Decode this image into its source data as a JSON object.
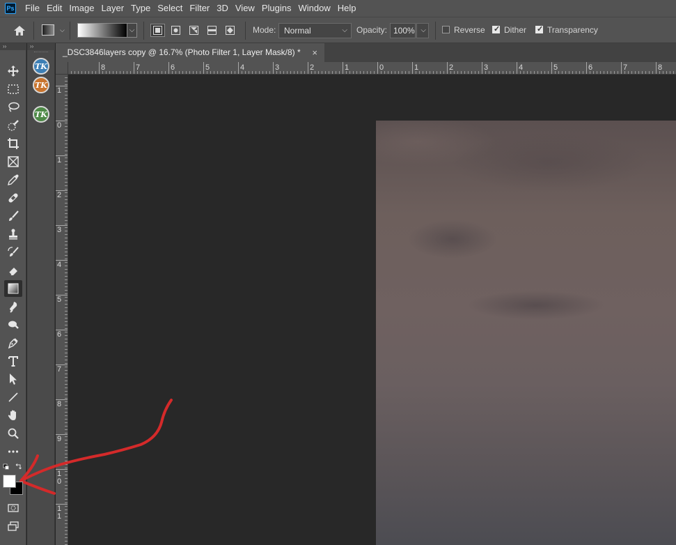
{
  "app": {
    "logo": "Ps"
  },
  "menu": [
    "File",
    "Edit",
    "Image",
    "Layer",
    "Type",
    "Select",
    "Filter",
    "3D",
    "View",
    "Plugins",
    "Window",
    "Help"
  ],
  "options": {
    "mode_label": "Mode:",
    "mode_value": "Normal",
    "opacity_label": "Opacity:",
    "opacity_value": "100%",
    "reverse_label": "Reverse",
    "reverse_checked": false,
    "dither_label": "Dither",
    "dither_checked": true,
    "transparency_label": "Transparency",
    "transparency_checked": true
  },
  "panel_collapse": "››",
  "document": {
    "tab_title": "_DSC3846layers copy @ 16.7% (Photo Filter 1, Layer Mask/8) *",
    "close_glyph": "×"
  },
  "ruler": {
    "horizontal_labels": [
      "8",
      "7",
      "6",
      "5",
      "4",
      "3",
      "2",
      "1",
      "0",
      "1",
      "2",
      "3",
      "4",
      "5",
      "6",
      "7",
      "8"
    ],
    "vertical_labels": [
      "1",
      "0",
      "1",
      "2",
      "3",
      "4",
      "5",
      "6",
      "7",
      "8",
      "9",
      "10",
      "11"
    ]
  },
  "tools": [
    {
      "name": "move-tool"
    },
    {
      "name": "marquee-tool"
    },
    {
      "name": "lasso-tool"
    },
    {
      "name": "quick-selection-tool"
    },
    {
      "name": "crop-tool"
    },
    {
      "name": "frame-tool"
    },
    {
      "name": "eyedropper-tool"
    },
    {
      "name": "healing-brush-tool"
    },
    {
      "name": "brush-tool"
    },
    {
      "name": "clone-stamp-tool"
    },
    {
      "name": "history-brush-tool"
    },
    {
      "name": "eraser-tool"
    },
    {
      "name": "gradient-tool",
      "active": true
    },
    {
      "name": "blur-tool"
    },
    {
      "name": "dodge-tool"
    },
    {
      "name": "pen-tool"
    },
    {
      "name": "type-tool"
    },
    {
      "name": "path-selection-tool"
    },
    {
      "name": "line-tool"
    },
    {
      "name": "hand-tool"
    },
    {
      "name": "zoom-tool"
    },
    {
      "name": "more-tools"
    }
  ],
  "tk_panels": [
    "TK",
    "TK",
    "TK"
  ],
  "colors": {
    "foreground": "#ffffff",
    "background": "#000000",
    "annotation": "#d42a2a"
  }
}
